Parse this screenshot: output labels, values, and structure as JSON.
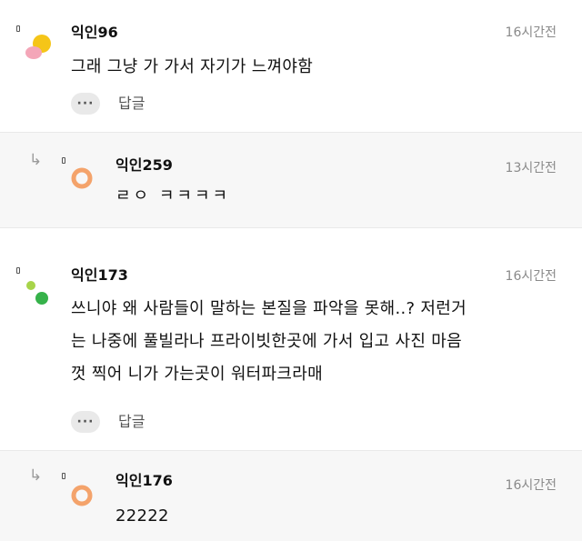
{
  "comments": [
    {
      "nickname": "익인96",
      "time": "16시간전",
      "text": "그래 그냥 가 가서 자기가 느껴야함",
      "reply_label": "답글",
      "more_label": "···"
    },
    {
      "nickname": "익인259",
      "time": "13시간전",
      "text": "ㄹㅇ ㅋㅋㅋㅋ"
    },
    {
      "nickname": "익인173",
      "time": "16시간전",
      "text_lines": [
        "쓰니야 왜 사람들이 말하는 본질을 파악을 못해..? 저런거",
        "는 나중에 풀빌라나 프라이빗한곳에 가서 입고 사진 마음",
        "껏 찍어 니가 가는곳이 워터파크라매"
      ],
      "reply_label": "답글",
      "more_label": "···"
    },
    {
      "nickname": "익인176",
      "time": "16시간전",
      "text": "22222"
    }
  ],
  "reply_arrow_glyph": "↳",
  "colors": {
    "avatar1_yellow": "#f5c518",
    "avatar1_pink": "#f4a6b8",
    "avatar_orange": "#f4a36b",
    "avatar3_lime": "#a7d44a",
    "avatar3_green": "#36b24a"
  }
}
